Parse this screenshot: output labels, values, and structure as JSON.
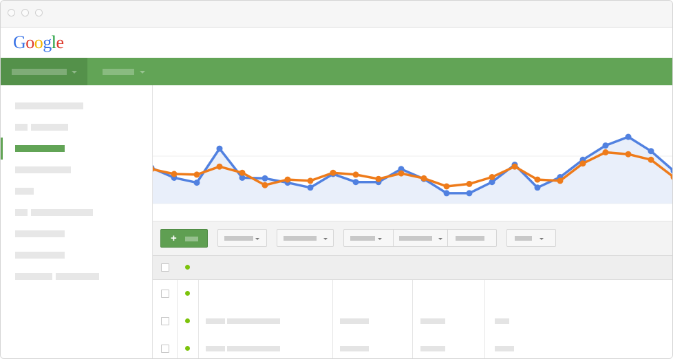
{
  "window": {
    "controls": [
      "close",
      "minimize",
      "zoom"
    ]
  },
  "logo": {
    "text": "Google",
    "letters": [
      "G",
      "o",
      "o",
      "g",
      "l",
      "e"
    ],
    "colors": [
      "#3b74e6",
      "#dd3a2b",
      "#f4b400",
      "#3b74e6",
      "#1f9d3b",
      "#dd3a2b"
    ]
  },
  "nav": {
    "background": "#62a456",
    "active_background": "#54914a",
    "items": [
      {
        "placeholder": true,
        "active": true,
        "has_dropdown": true
      },
      {
        "placeholder": true,
        "active": false,
        "has_dropdown": true
      }
    ]
  },
  "sidebar": {
    "active_index": 2,
    "active_color": "#62a456",
    "item_count": 9
  },
  "chart_data": {
    "type": "line",
    "grid": true,
    "ylim": [
      0,
      100
    ],
    "x": [
      0,
      1,
      2,
      3,
      4,
      5,
      6,
      7,
      8,
      9,
      10,
      11,
      12,
      13,
      14,
      15,
      16,
      17,
      18,
      19,
      20,
      21,
      22,
      23
    ],
    "series": [
      {
        "color": "#5181e0",
        "fill": "#e9effa",
        "values": [
          50,
          34,
          26,
          81,
          34,
          33,
          26,
          18,
          40,
          27,
          27,
          48,
          32,
          9,
          9,
          27,
          55,
          18,
          35,
          63,
          86,
          100,
          77,
          45
        ]
      },
      {
        "color": "#ee7b1a",
        "values": [
          48,
          40,
          39,
          52,
          42,
          22,
          31,
          29,
          42,
          39,
          32,
          41,
          33,
          20,
          24,
          35,
          52,
          31,
          29,
          57,
          75,
          72,
          63,
          35
        ]
      }
    ]
  },
  "toolbar": {
    "add_button": {
      "icon": "plus-icon",
      "color": "#5f9f52"
    },
    "dropdowns": 6
  },
  "table": {
    "status_color": "#7cc30b",
    "rows": 3
  }
}
